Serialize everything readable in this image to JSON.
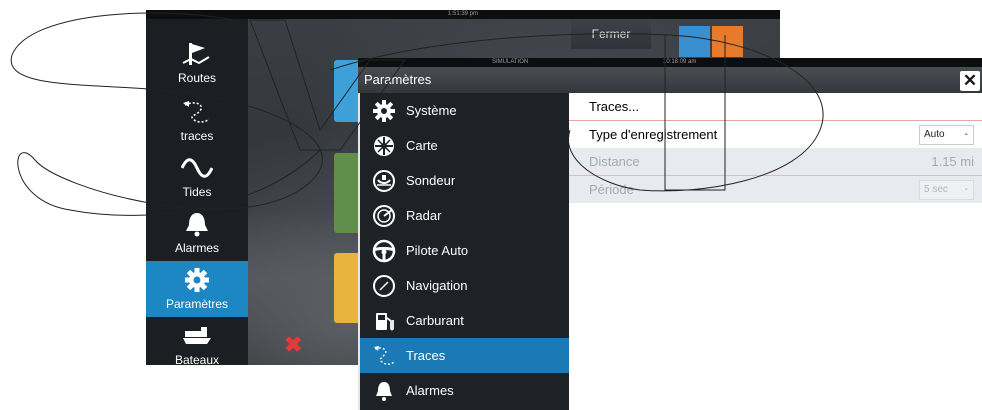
{
  "background": {
    "clock": "1:51:39 pm",
    "fermer_label": "Fermer",
    "sidebar": [
      {
        "label": "Routes",
        "icon": "routes-flag-icon"
      },
      {
        "label": "traces",
        "icon": "traces-icon"
      },
      {
        "label": "Tides",
        "icon": "tides-wave-icon"
      },
      {
        "label": "Alarmes",
        "icon": "bell-icon"
      },
      {
        "label": "Paramètres",
        "icon": "gear-icon",
        "active": true
      },
      {
        "label": "Bateaux",
        "icon": "ship-icon"
      }
    ]
  },
  "dialog": {
    "status_simulation": "SIMULATION",
    "status_time": "10:18:09 am",
    "title": "Paramètres",
    "menu": [
      {
        "label": "Système",
        "icon": "gear-icon"
      },
      {
        "label": "Carte",
        "icon": "chart-wheel-icon"
      },
      {
        "label": "Sondeur",
        "icon": "sounder-icon"
      },
      {
        "label": "Radar",
        "icon": "radar-icon"
      },
      {
        "label": "Pilote Auto",
        "icon": "steering-wheel-icon"
      },
      {
        "label": "Navigation",
        "icon": "compass-icon"
      },
      {
        "label": "Carburant",
        "icon": "fuel-pump-icon"
      },
      {
        "label": "Traces",
        "icon": "traces-icon",
        "active": true
      },
      {
        "label": "Alarmes",
        "icon": "bell-icon"
      }
    ],
    "content": {
      "traces_link": "Traces...",
      "record_type_label": "Type d'enregistrement",
      "record_type_value": "Auto",
      "distance_label": "Distance",
      "distance_value": "1.15 mi",
      "period_label": "Période",
      "period_value": "5 sec"
    }
  },
  "colors": {
    "accent": "#1b7ab5",
    "sidebar_active": "#1d87c3",
    "dialog_bg": "#1e2125"
  }
}
